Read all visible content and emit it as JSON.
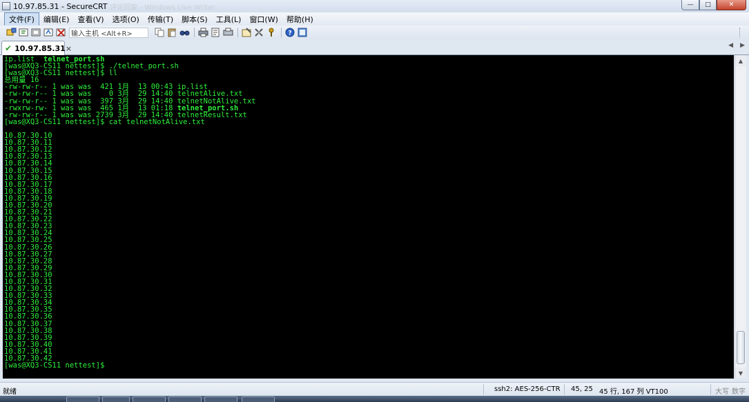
{
  "window": {
    "title": "10.97.85.31 - SecureCRT",
    "title_ghost": "评论回复 - Windows Live Writer",
    "controls": {
      "minimize": "—",
      "maximize": "□",
      "close": "✕"
    }
  },
  "menu": [
    {
      "label": "文件(F)",
      "active": true
    },
    {
      "label": "编辑(E)"
    },
    {
      "label": "查看(V)"
    },
    {
      "label": "选项(O)"
    },
    {
      "label": "传输(T)"
    },
    {
      "label": "脚本(S)"
    },
    {
      "label": "工具(L)"
    },
    {
      "label": "窗口(W)"
    },
    {
      "label": "帮助(H)"
    }
  ],
  "toolbar": {
    "quick_connect_placeholder": "输入主机 <Alt+R>"
  },
  "tab": {
    "label": "10.97.85.31",
    "close": "×",
    "nav_left": "◀",
    "nav_right": "▶"
  },
  "terminal": {
    "lines": [
      {
        "text": "ip.list  telnet_port.sh",
        "bold_part": "telnet_port.sh"
      },
      {
        "text": "[was@XQ3-CS11 nettest]$ ./telnet_port.sh"
      },
      {
        "text": "[was@XQ3-CS11 nettest]$ ll"
      },
      {
        "text": "总用量 16"
      },
      {
        "text": "-rw-rw-r-- 1 was was  421 1月  13 00:43 ip.list"
      },
      {
        "text": "-rw-rw-r-- 1 was was    0 3月  29 14:40 telnetAlive.txt"
      },
      {
        "text": "-rw-rw-r-- 1 was was  397 3月  29 14:40 telnetNotAlive.txt"
      },
      {
        "text": "-rwxrw-rw- 1 was was  465 1月  13 01:18 telnet_port.sh",
        "bold_part": "telnet_port.sh"
      },
      {
        "text": "-rw-rw-r-- 1 was was 2739 3月  29 14:40 telnetResult.txt"
      },
      {
        "text": "[was@XQ3-CS11 nettest]$ cat telnetNotAlive.txt"
      },
      {
        "text": ""
      },
      {
        "text": "10.87.30.10"
      },
      {
        "text": "10.87.30.11"
      },
      {
        "text": "10.87.30.12"
      },
      {
        "text": "10.87.30.13"
      },
      {
        "text": "10.87.30.14"
      },
      {
        "text": "10.87.30.15"
      },
      {
        "text": "10.87.30.16"
      },
      {
        "text": "10.87.30.17"
      },
      {
        "text": "10.87.30.18"
      },
      {
        "text": "10.87.30.19"
      },
      {
        "text": "10.87.30.20"
      },
      {
        "text": "10.87.30.21"
      },
      {
        "text": "10.87.30.22"
      },
      {
        "text": "10.87.30.23"
      },
      {
        "text": "10.87.30.24"
      },
      {
        "text": "10.87.30.25"
      },
      {
        "text": "10.87.30.26"
      },
      {
        "text": "10.87.30.27"
      },
      {
        "text": "10.87.30.28"
      },
      {
        "text": "10.87.30.29"
      },
      {
        "text": "10.87.30.30"
      },
      {
        "text": "10.87.30.31"
      },
      {
        "text": "10.87.30.32"
      },
      {
        "text": "10.87.30.33"
      },
      {
        "text": "10.87.30.34"
      },
      {
        "text": "10.87.30.35"
      },
      {
        "text": "10.87.30.36"
      },
      {
        "text": "10.87.30.37"
      },
      {
        "text": "10.87.30.38"
      },
      {
        "text": "10.87.30.39"
      },
      {
        "text": "10.87.30.40"
      },
      {
        "text": "10.87.30.41"
      },
      {
        "text": "10.87.30.42"
      },
      {
        "text": "[was@XQ3-CS11 nettest]$"
      }
    ],
    "text_color": "#2ff03c",
    "background": "#000000"
  },
  "statusbar": {
    "ready": "就绪",
    "session": "ssh2: AES-256-CTR",
    "cursor": "45,  25",
    "size": "45 行, 167 列 VT100",
    "caps": "大写",
    "num": "数字"
  }
}
